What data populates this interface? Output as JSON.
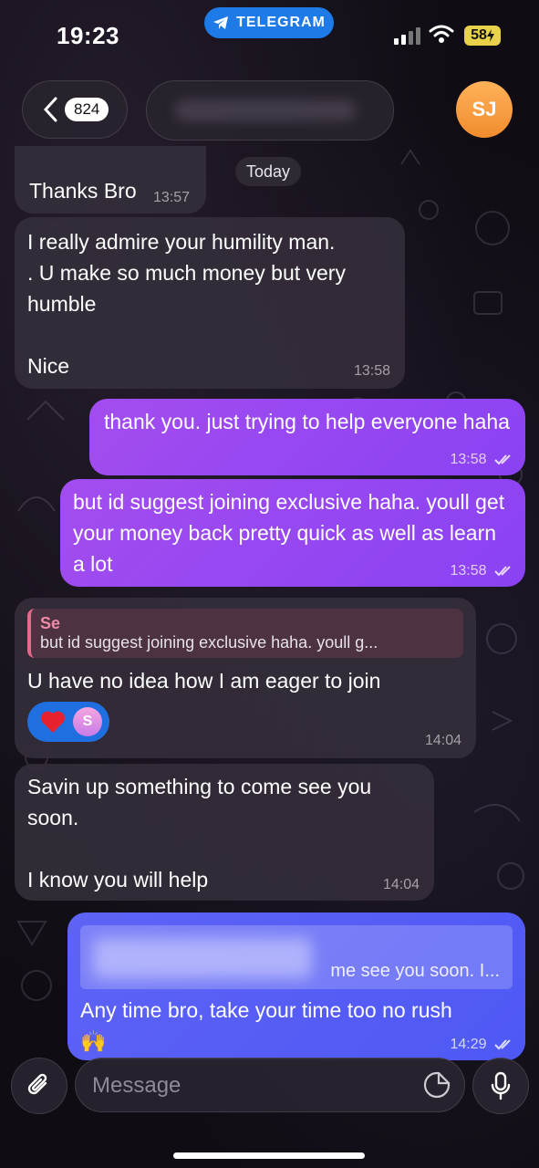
{
  "status_bar": {
    "time": "19:23",
    "app_pill": "TELEGRAM",
    "battery": "58"
  },
  "header": {
    "unread_count": "824",
    "avatar_initials": "SJ"
  },
  "date_chip": "Today",
  "messages": [
    {
      "text": "Thanks Bro",
      "time": "13:57"
    },
    {
      "text": "I really admire your humility man.\n. U make so much money but very humble\n\nNice",
      "time": "13:58"
    },
    {
      "text": "thank you. just trying to help everyone haha",
      "time": "13:58"
    },
    {
      "text": "but id suggest joining exclusive haha. youll get your money back pretty quick as well as learn a lot",
      "time": "13:58"
    },
    {
      "reply_name": "Se",
      "reply_text": "but id suggest joining exclusive haha. youll g...",
      "text": "U have no idea how I am eager to join",
      "reaction_avatar": "S",
      "time": "14:04"
    },
    {
      "text": "Savin up something to come see you soon.\n\nI know you will help",
      "time": "14:04"
    },
    {
      "reply_text": "me see you soon. I...",
      "text": "Any time bro, take your time too no rush",
      "emoji": "🙌",
      "time": "14:29"
    }
  ],
  "composer": {
    "placeholder": "Message"
  }
}
